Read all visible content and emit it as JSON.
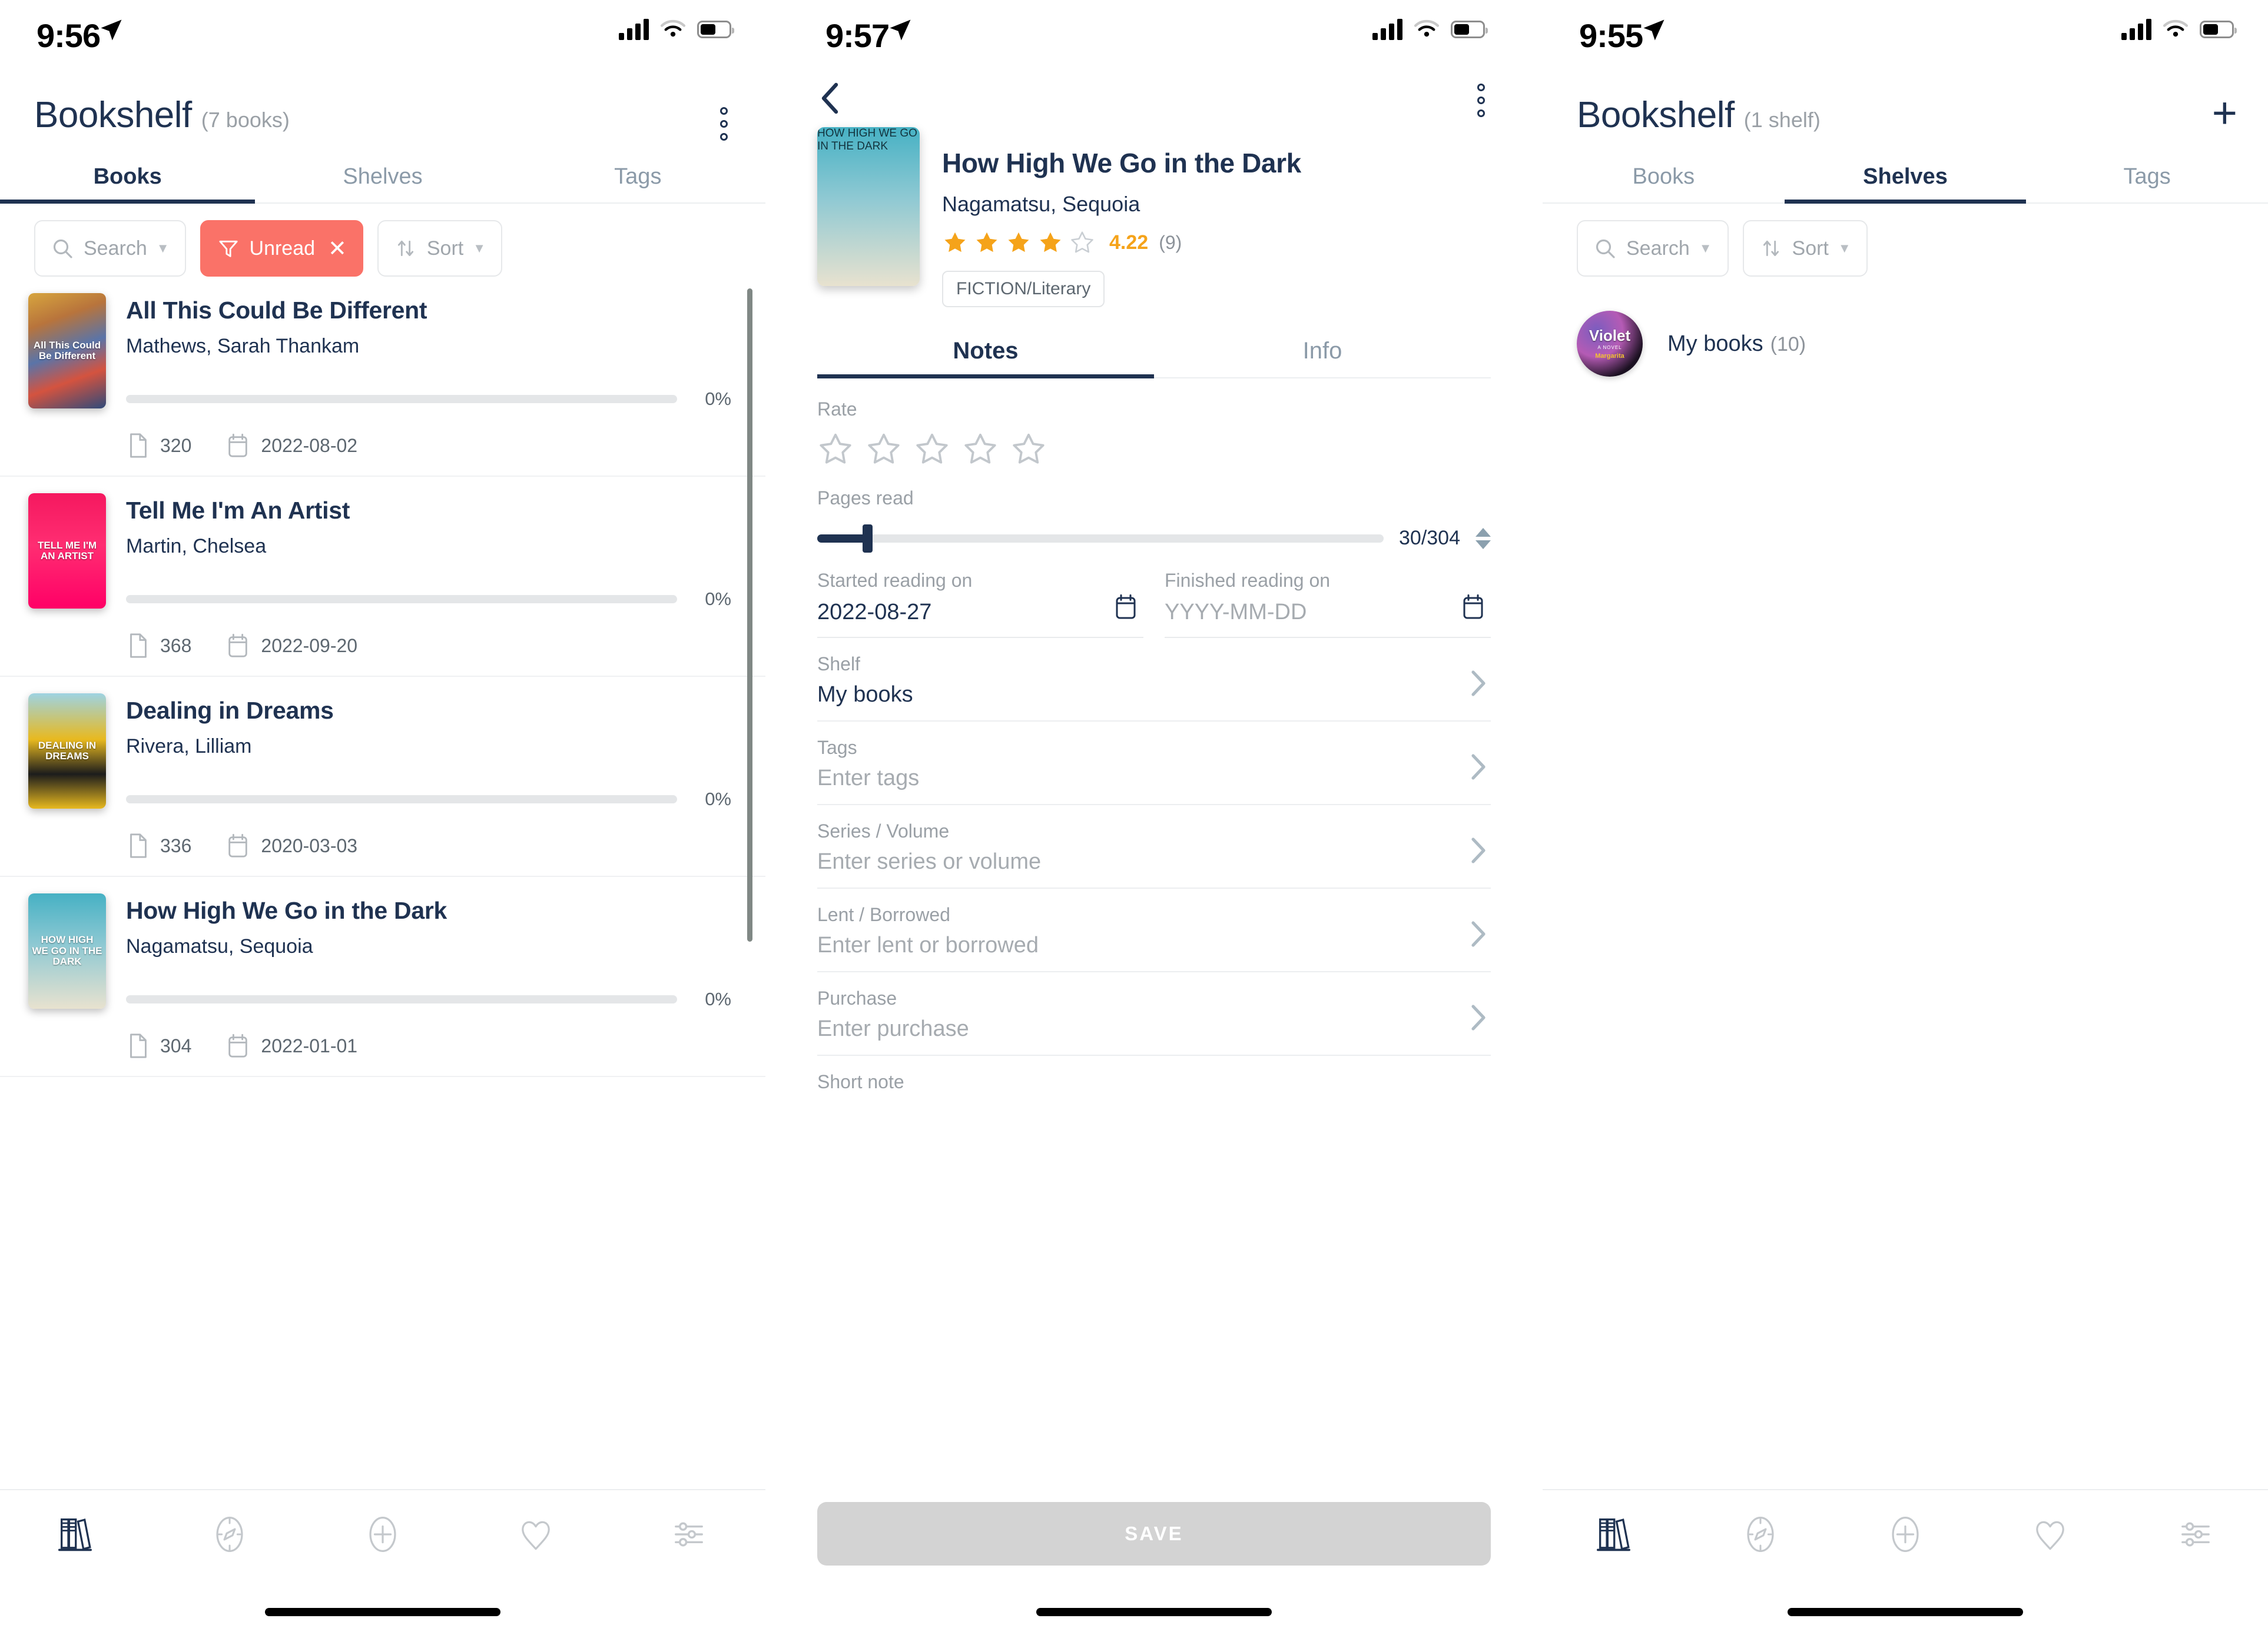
{
  "screens": [
    {
      "id": "books-list",
      "status_bar": {
        "time": "9:56",
        "location_arrow": "location-arrow-icon",
        "signal": "cellular-bars-icon",
        "wifi": "wifi-icon",
        "battery": "battery-icon"
      },
      "header": {
        "title": "Bookshelf",
        "subtitle": "(7 books)",
        "action": "overflow-menu"
      },
      "tabs": [
        {
          "label": "Books",
          "active": true
        },
        {
          "label": "Shelves",
          "active": false
        },
        {
          "label": "Tags",
          "active": false
        }
      ],
      "filters": {
        "search_label": "Search",
        "active_filter_label": "Unread",
        "active_filter_color": "#fa7268",
        "sort_label": "Sort"
      },
      "books": [
        {
          "title": "All This Could Be Different",
          "author": "Mathews, Sarah Thankam",
          "progress": "0%",
          "progress_value": 0,
          "pages": "320",
          "date": "2022-08-02",
          "cover_text": "All This Could Be Different",
          "cover_bg": "#c4a35a"
        },
        {
          "title": "Tell Me I'm An Artist",
          "author": "Martin, Chelsea",
          "progress": "0%",
          "progress_value": 0,
          "pages": "368",
          "date": "2022-09-20",
          "cover_text": "TELL ME I'M AN ARTIST",
          "cover_bg": "#f5185f"
        },
        {
          "title": "Dealing in Dreams",
          "author": "Rivera, Lilliam",
          "progress": "0%",
          "progress_value": 0,
          "pages": "336",
          "date": "2020-03-03",
          "cover_text": "DEALING IN DREAMS",
          "cover_bg": "#8ec6d8"
        },
        {
          "title": "How High We Go in the Dark",
          "author": "Nagamatsu, Sequoia",
          "progress": "0%",
          "progress_value": 0,
          "pages": "304",
          "date": "2022-01-01",
          "cover_text": "HOW HIGH WE GO IN THE DARK",
          "cover_bg": "#4fb0c0"
        }
      ],
      "bottom_nav": [
        "bookshelf-icon",
        "compass-icon",
        "plus-circle-icon",
        "heart-icon",
        "sliders-icon"
      ]
    },
    {
      "id": "book-detail",
      "status_bar": {
        "time": "9:57"
      },
      "back": "back-chevron",
      "overflow": "overflow-menu",
      "book": {
        "title": "How High We Go in the Dark",
        "author": "Nagamatsu, Sequoia",
        "rating_stars": 4,
        "rating_value": "4.22",
        "rating_count": "(9)",
        "genre": "FICTION/Literary",
        "cover_text": "HOW HIGH WE GO IN THE DARK"
      },
      "tabs": [
        {
          "label": "Notes",
          "active": true
        },
        {
          "label": "Info",
          "active": false
        }
      ],
      "form": {
        "rate_label": "Rate",
        "rate_stars_filled": 0,
        "pages_read_label": "Pages read",
        "pages_read_value": "30/304",
        "pages_read_pct": 9.87,
        "started_label": "Started reading on",
        "started_value": "2022-08-27",
        "finished_label": "Finished reading on",
        "finished_placeholder": "YYYY-MM-DD",
        "shelf_label": "Shelf",
        "shelf_value": "My books",
        "tags_label": "Tags",
        "tags_placeholder": "Enter tags",
        "series_label": "Series / Volume",
        "series_placeholder": "Enter series or volume",
        "lent_label": "Lent / Borrowed",
        "lent_placeholder": "Enter lent or borrowed",
        "purchase_label": "Purchase",
        "purchase_placeholder": "Enter purchase",
        "short_note_label": "Short note",
        "save_label": "SAVE"
      }
    },
    {
      "id": "shelves-list",
      "status_bar": {
        "time": "9:55"
      },
      "header": {
        "title": "Bookshelf",
        "subtitle": "(1 shelf)",
        "action": "add-shelf"
      },
      "tabs": [
        {
          "label": "Books",
          "active": false
        },
        {
          "label": "Shelves",
          "active": true
        },
        {
          "label": "Tags",
          "active": false
        }
      ],
      "filters": {
        "search_label": "Search",
        "sort_label": "Sort"
      },
      "shelves": [
        {
          "name": "My books",
          "count": "(10)",
          "avatar_text": "Violet",
          "avatar_sub": "A NOVEL",
          "avatar_author": "Margarita"
        }
      ],
      "bottom_nav": [
        "bookshelf-icon",
        "compass-icon",
        "plus-circle-icon",
        "heart-icon",
        "sliders-icon"
      ]
    }
  ]
}
